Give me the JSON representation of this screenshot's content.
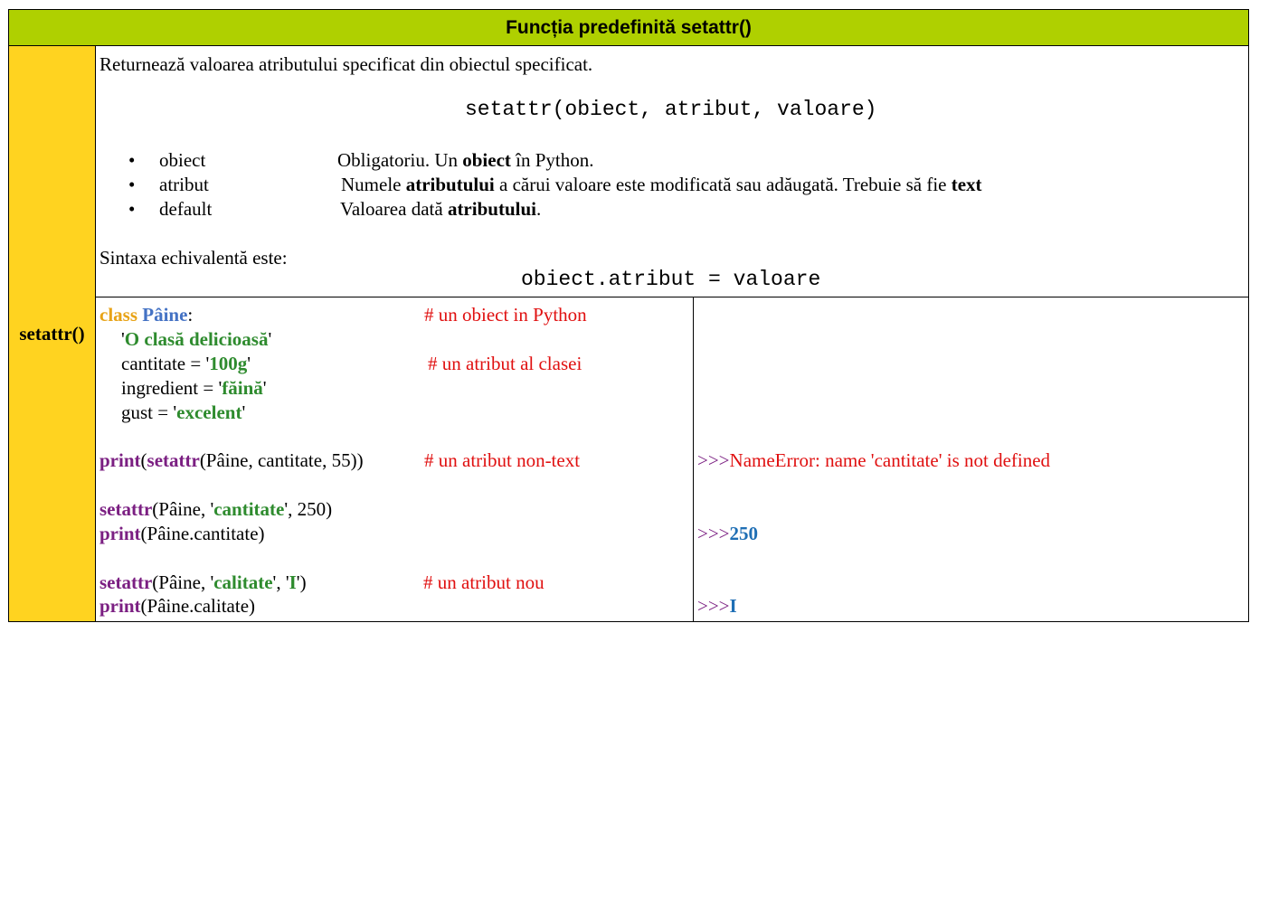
{
  "header": {
    "title": "Funcția predefinită setattr()"
  },
  "side": {
    "label": "setattr()"
  },
  "description": {
    "intro": "Returnează valoarea atributului specificat din obiectul specificat.",
    "syntax": "setattr(obiect, atribut, valoare)",
    "params": [
      {
        "name": "obiect",
        "text_before": "Obligatoriu. Un ",
        "bold": "obiect",
        "text_after": " în Python.",
        "bold2": "",
        "text_after2": ""
      },
      {
        "name": "atribut",
        "text_before": "Numele ",
        "bold": "atributului",
        "text_after": " a cărui valoare este modificată sau adăugată. Trebuie să fie ",
        "bold2": "text",
        "text_after2": ""
      },
      {
        "name": "default",
        "text_before": "Valoarea dată ",
        "bold": "atributului",
        "text_after": ".",
        "bold2": "",
        "text_after2": ""
      }
    ],
    "equiv_label": "Sintaxa echivalentă este:",
    "equiv_syntax": "obiect.atribut = valoare"
  },
  "code": {
    "l1_kw": "class",
    "l1_cls": "Pâine",
    "l1_colon": ":",
    "l1_comment": "# un obiect in Python",
    "l2_q1": "'",
    "l2_str": "O clasă delicioasă",
    "l2_q2": "'",
    "l3_pre": "cantitate = '",
    "l3_str": "100g",
    "l3_post": "'",
    "l3_comment": "# un atribut al clasei",
    "l4_pre": "ingredient = '",
    "l4_str": "făină",
    "l4_post": "'",
    "l5_pre": "gust = '",
    "l5_str": "excelent",
    "l5_post": "'",
    "l6_fn1": "print",
    "l6_p1": "(",
    "l6_fn2": "setattr",
    "l6_rest": "(Pâine, cantitate, 55))",
    "l6_comment": "# un atribut non-text",
    "l7_fn": "setattr",
    "l7_pre": "(Pâine, '",
    "l7_str": "cantitate",
    "l7_post": "', 250)",
    "l8_fn": "print",
    "l8_rest": "(Pâine.cantitate)",
    "l9_fn": "setattr",
    "l9_pre": "(Pâine, '",
    "l9_str": "calitate",
    "l9_mid": "', '",
    "l9_str2": "I",
    "l9_post": "')",
    "l9_comment": "# un atribut nou",
    "l10_fn": "print",
    "l10_rest": "(Pâine.calitate)"
  },
  "output": {
    "o1_prompt": ">>>",
    "o1_text": "NameError: name 'cantitate' is not defined",
    "o2_prompt": ">>>",
    "o2_text": "250",
    "o3_prompt": ">>>",
    "o3_text": "I"
  },
  "colors": {
    "header_bg": "#afd000",
    "side_bg": "#ffd320",
    "keyword": "#e8a317",
    "class_name": "#4472c4",
    "string": "#2e8b2e",
    "function": "#7b1f82",
    "comment": "#e01010",
    "result": "#1f6fb5"
  }
}
